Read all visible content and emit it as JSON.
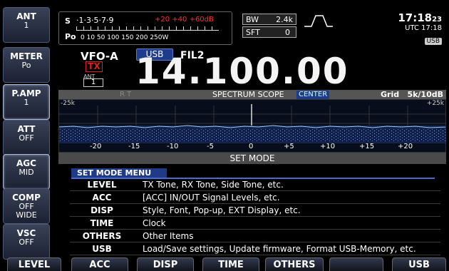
{
  "sidebar": [
    {
      "label": "ANT",
      "value": "1"
    },
    {
      "label": "METER",
      "value": "Po"
    },
    {
      "label": "P.AMP",
      "value": "1"
    },
    {
      "label": "ATT",
      "value": "OFF"
    },
    {
      "label": "AGC",
      "value": "MID"
    },
    {
      "label": "COMP",
      "value": "OFF",
      "value2": "WIDE"
    },
    {
      "label": "VSC",
      "value": "OFF"
    }
  ],
  "meter": {
    "s_label": "S",
    "s_scale": "·1·3·5·7·9",
    "s_red": "+20 +40 +60dB",
    "po_label": "Po",
    "po_scale": "0   10    50   100 150 200 250W"
  },
  "bw": {
    "label": "BW",
    "value": "2.4k"
  },
  "sft": {
    "label": "SFT",
    "value": "0"
  },
  "clock": {
    "time": "17:18",
    "seconds": "23",
    "utc": "UTC 17:18",
    "usb_badge": "USB"
  },
  "vfo": {
    "name": "VFO-A",
    "mode": "USB",
    "filter": "FIL2",
    "tx": "TX",
    "ant_label": "ANT",
    "ant_value": "1",
    "frequency": "14.100.00"
  },
  "spectrum": {
    "rt": "R T",
    "title": "SPECTRUM SCOPE",
    "center": "CENTER",
    "grid": "Grid",
    "span": "5k/10dB",
    "left": "-25k",
    "right": "+25k",
    "ticks": [
      "-20",
      "-15",
      "-10",
      "-5",
      "0",
      "+5",
      "+10",
      "+15",
      "+20"
    ]
  },
  "setmode": {
    "title": "SET MODE",
    "menu_title": "SET MODE MENU",
    "items": [
      {
        "key": "LEVEL",
        "desc": "TX Tone, RX Tone, Side Tone, etc."
      },
      {
        "key": "ACC",
        "desc": "[ACC] IN/OUT Signal Levels, etc."
      },
      {
        "key": "DISP",
        "desc": "Style, Font, Pop-up, EXT Display, etc."
      },
      {
        "key": "TIME",
        "desc": "Clock"
      },
      {
        "key": "OTHERS",
        "desc": "Other Items"
      },
      {
        "key": "USB",
        "desc": "Load/Save settings, Update firmware, Format USB-Memory, etc."
      }
    ]
  },
  "bottom": [
    "LEVEL",
    "ACC",
    "DISP",
    "TIME",
    "OTHERS",
    "",
    "USB"
  ]
}
